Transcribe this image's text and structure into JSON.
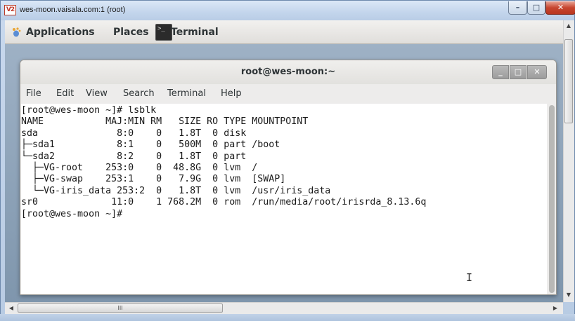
{
  "outer_window": {
    "title": "wes-moon.vaisala.com:1 (root)",
    "icon_label": "V2",
    "minimize": "–",
    "maximize": "□",
    "close": "✕"
  },
  "gnome_panel": {
    "applications": "Applications",
    "places": "Places",
    "terminal": "Terminal"
  },
  "terminal_window": {
    "title": "root@wes-moon:~",
    "minimize": "_",
    "maximize": "□",
    "close": "✕"
  },
  "menu": [
    "File",
    "Edit",
    "View",
    "Search",
    "Terminal",
    "Help"
  ],
  "terminal_lines": [
    "[root@wes-moon ~]# lsblk",
    "NAME           MAJ:MIN RM   SIZE RO TYPE MOUNTPOINT",
    "sda              8:0    0   1.8T  0 disk",
    "├─sda1           8:1    0   500M  0 part /boot",
    "└─sda2           8:2    0   1.8T  0 part",
    "  ├─VG-root    253:0    0  48.8G  0 lvm  /",
    "  ├─VG-swap    253:1    0   7.9G  0 lvm  [SWAP]",
    "  └─VG-iris_data 253:2  0   1.8T  0 lvm  /usr/iris_data",
    "sr0             11:0    1 768.2M  0 rom  /run/media/root/irisrda_8.13.6q",
    "[root@wes-moon ~]#"
  ],
  "hscroll_grip": "III",
  "cursor_glyph": "I"
}
